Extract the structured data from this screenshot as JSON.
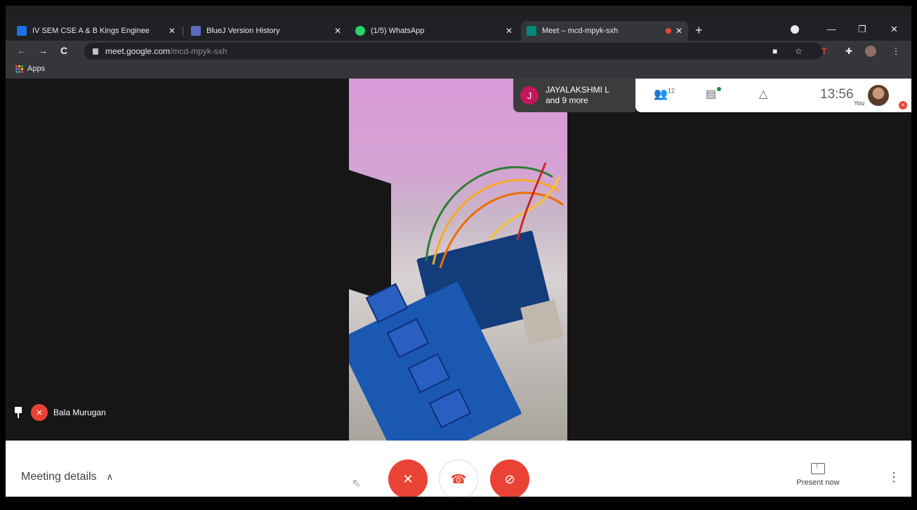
{
  "browser": {
    "tabs": [
      {
        "title": "IV SEM CSE A & B Kings Enginee",
        "favicon_color": "#1a73e8",
        "close": "✕"
      },
      {
        "title": "BlueJ Version History",
        "favicon_color": "#5c6bc0",
        "close": "✕"
      },
      {
        "title": "(1/5) WhatsApp",
        "favicon_color": "#25d366",
        "close": "✕"
      },
      {
        "title": "Meet – mcd-mpyk-sxh",
        "favicon_color": "#00897b",
        "close": "✕",
        "active": true
      }
    ],
    "new_tab": "+",
    "window_controls": {
      "minimize": "—",
      "restore": "❐",
      "close": "✕"
    },
    "nav": {
      "back": "←",
      "forward": "→",
      "reload": "C"
    },
    "url_host": "meet.google.com",
    "url_path": "/mcd-mpyk-sxh",
    "toolbar_icons": [
      "camera-icon",
      "star-icon",
      "extension-icon",
      "puzzle-icon",
      "profile-icon",
      "menu-icon"
    ],
    "bookmarks": {
      "apps_label": "Apps"
    }
  },
  "meet": {
    "participant_name": "Bala Murugan",
    "join_chip": {
      "avatar_letter": "J",
      "line1": "JAYALAKSHMI L",
      "line2": "and 9 more"
    },
    "people_count": "12",
    "time": "13:56",
    "you_label": "You",
    "accent": "#ea4335"
  },
  "bottom": {
    "meeting_details": "Meeting details",
    "present_now": "Present now"
  }
}
